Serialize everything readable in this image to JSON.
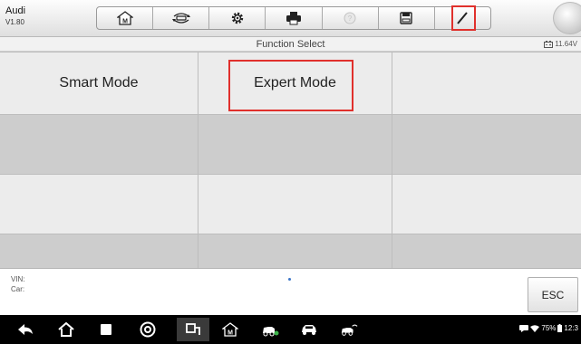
{
  "header": {
    "app_name": "Audi",
    "version": "V1.80"
  },
  "toolbar": {
    "items": [
      {
        "icon": "home-m-icon"
      },
      {
        "icon": "vehicle-swap-icon"
      },
      {
        "icon": "gear-icon"
      },
      {
        "icon": "printer-icon"
      },
      {
        "icon": "help-icon"
      },
      {
        "icon": "save-icon"
      },
      {
        "icon": "pencil-icon"
      }
    ]
  },
  "subtitle": {
    "title": "Function Select",
    "voltage": "11.64V"
  },
  "grid": {
    "cells": [
      [
        "Smart Mode",
        "Expert Mode",
        ""
      ],
      [
        "",
        "",
        ""
      ],
      [
        "",
        "",
        ""
      ],
      [
        "",
        "",
        ""
      ]
    ]
  },
  "info": {
    "vin_label": "VIN:",
    "car_label": "Car:",
    "esc_label": "ESC"
  },
  "status": {
    "battery": "75%",
    "time": "12:3"
  },
  "colors": {
    "highlight": "#e0302c",
    "accent_dot": "#3a74c8"
  }
}
